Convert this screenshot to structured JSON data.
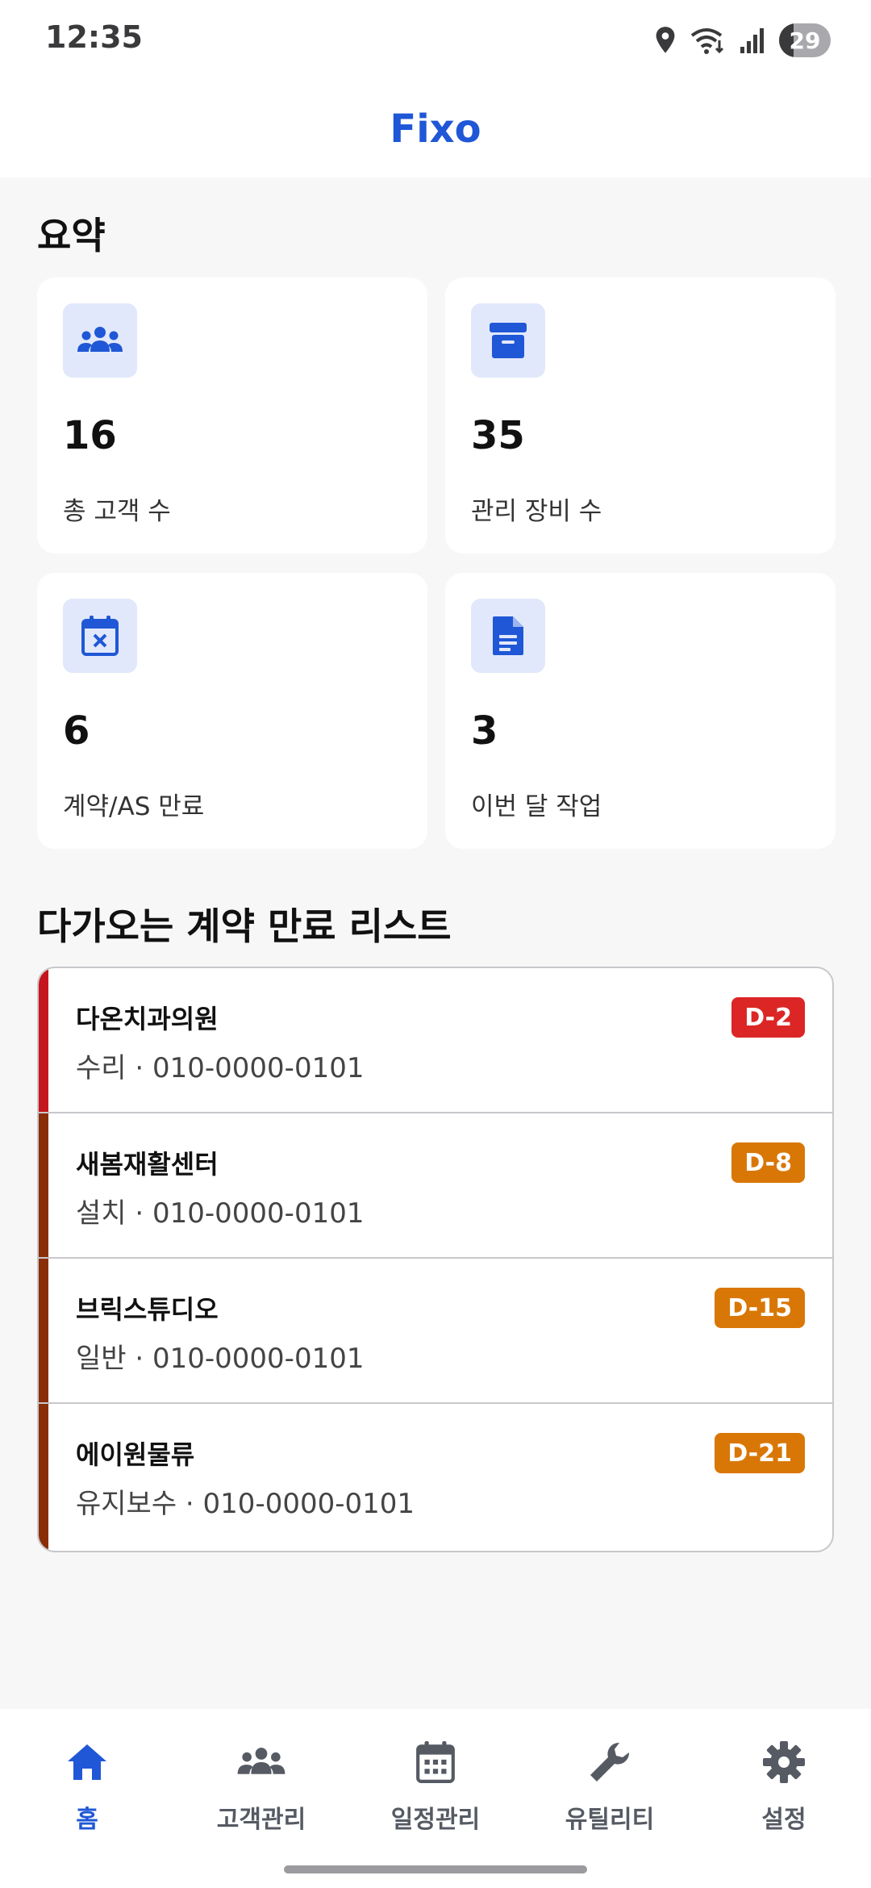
{
  "status_bar": {
    "time": "12:35",
    "battery_level": "29"
  },
  "app": {
    "title": "Fixo",
    "accent_color": "#1f57d6"
  },
  "summary": {
    "title": "요약",
    "cards": [
      {
        "icon": "people-icon",
        "value": "16",
        "label": "총 고객 수"
      },
      {
        "icon": "archive-box-icon",
        "value": "35",
        "label": "관리 장비 수"
      },
      {
        "icon": "calendar-cancel-icon",
        "value": "6",
        "label": "계약/AS 만료"
      },
      {
        "icon": "document-icon",
        "value": "3",
        "label": "이번 달 작업"
      }
    ]
  },
  "contracts": {
    "title": "다가오는 계약 만료 리스트",
    "items": [
      {
        "name": "다온치과의원",
        "detail": "수리 · 010-0000-0101",
        "badge": "D-2",
        "badge_color": "#dc2626",
        "accent_color": "#c5161d"
      },
      {
        "name": "새봄재활센터",
        "detail": "설치 · 010-0000-0101",
        "badge": "D-8",
        "badge_color": "#d97706",
        "accent_color": "#8a2e05"
      },
      {
        "name": "브릭스튜디오",
        "detail": "일반 · 010-0000-0101",
        "badge": "D-15",
        "badge_color": "#d97706",
        "accent_color": "#8a2e05"
      },
      {
        "name": "에이원물류",
        "detail": "유지보수 · 010-0000-0101",
        "badge": "D-21",
        "badge_color": "#d97706",
        "accent_color": "#8a2e05"
      }
    ]
  },
  "bottom_nav": {
    "items": [
      {
        "icon": "home-icon",
        "label": "홈",
        "active": true
      },
      {
        "icon": "people-icon",
        "label": "고객관리",
        "active": false
      },
      {
        "icon": "calendar-icon",
        "label": "일정관리",
        "active": false
      },
      {
        "icon": "wrench-icon",
        "label": "유틸리티",
        "active": false
      },
      {
        "icon": "gear-icon",
        "label": "설정",
        "active": false
      }
    ]
  }
}
